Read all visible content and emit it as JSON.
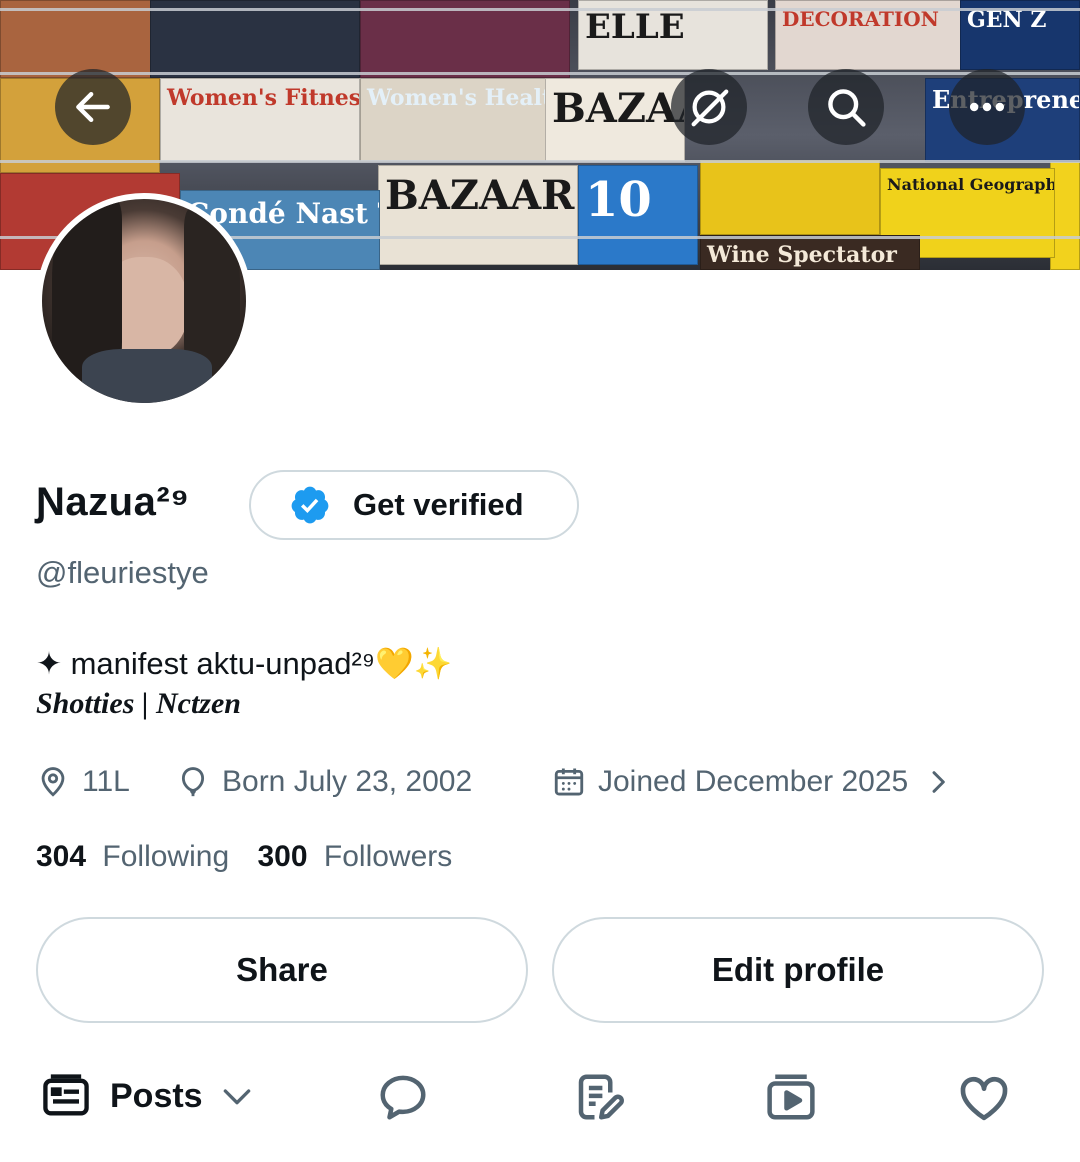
{
  "header": {
    "back_icon": "arrow-left-icon",
    "grok_icon": "grok-icon",
    "search_icon": "search-icon",
    "more_icon": "more-horizontal-icon"
  },
  "banner": {
    "magazines": [
      "Women's Fitness",
      "Women's Health",
      "BAZAAR",
      "BAZAAR",
      "Condé Nast Traveler",
      "National Geographic",
      "ELLE",
      "DECORATION",
      "Entrepreneur",
      "Wine Spectator",
      "GEN Z",
      "10"
    ]
  },
  "profile": {
    "display_name": "Ɲazua²⁹",
    "get_verified_label": "Get verified",
    "handle": "@fleuriestye",
    "bio_line1": "✦ manifest aktu-unpad²⁹💛✨",
    "bio_line2": "Shotties | Nctzen",
    "location": "11L",
    "birthday": "Born July 23, 2002",
    "joined": "Joined December 2025",
    "following_count": "304",
    "following_label": "Following",
    "followers_count": "300",
    "followers_label": "Followers"
  },
  "actions": {
    "share_label": "Share",
    "edit_profile_label": "Edit profile"
  },
  "tabs": {
    "posts_label": "Posts"
  },
  "colors": {
    "verified_blue": "#1d9bf0",
    "secondary_text": "#536471",
    "border": "#cfd9de"
  }
}
